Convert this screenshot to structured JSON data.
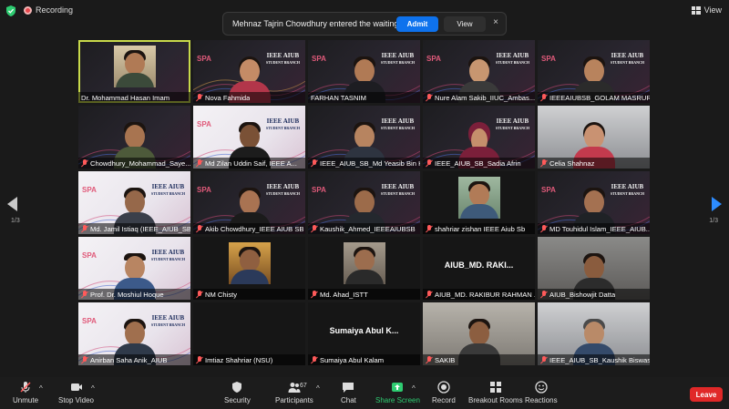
{
  "topbar": {
    "recording_label": "Recording",
    "view_label": "View"
  },
  "notification": {
    "message": "Mehnaz Tajrin Chowdhury entered the waiting room",
    "admit_label": "Admit",
    "view_label": "View",
    "close_glyph": "×"
  },
  "pagination": {
    "left": "1/3",
    "right": "1/3"
  },
  "branding": {
    "spa": "SPA",
    "ieee_line1": "IEEE AIUB",
    "ieee_line2": "STUDENT BRANCH"
  },
  "participants": [
    {
      "name": "Dr. Mohammad Hasan Imam",
      "muted": false
    },
    {
      "name": "Nova Fahmida",
      "muted": true
    },
    {
      "name": "FARHAN TASNIM",
      "muted": false
    },
    {
      "name": "Nure Alam Sakib_IIUC_Ambas...",
      "muted": true
    },
    {
      "name": "IEEEAIUBSB_GOLAM MASRUR...",
      "muted": true
    },
    {
      "name": "Chowdhury_Mohammad_Saye...",
      "muted": true
    },
    {
      "name": "Md Zilan Uddin Saif, IEEE A...",
      "muted": true
    },
    {
      "name": "IEEE_AIUB_SB_Md Yeasib Bin Has...",
      "muted": true
    },
    {
      "name": "IEEE_AIUB_SB_Sadia Afrin",
      "muted": true
    },
    {
      "name": "Celia Shahnaz",
      "muted": true
    },
    {
      "name": "Md. Jamil Istiaq (IEEE_AIUB_SB)",
      "muted": true
    },
    {
      "name": "Akib Chowdhury_IEEE AIUB SB",
      "muted": true
    },
    {
      "name": "Kaushik_Ahmed_IEEEAIUBSB",
      "muted": true
    },
    {
      "name": "shahriar zishan IEEE Aiub Sb",
      "muted": true
    },
    {
      "name": "MD Touhidul Islam_IEEE_AIUB...",
      "muted": true
    },
    {
      "name": "Prof. Dr. Moshiul Hoque",
      "muted": true
    },
    {
      "name": "NM Chisty",
      "muted": true
    },
    {
      "name": "Md. Ahad_ISTT",
      "muted": true
    },
    {
      "name": "AIUB_MD. RAKIBUR RAHMAN ...",
      "muted": true,
      "big_label": "AIUB_MD. RAKI..."
    },
    {
      "name": "AIUB_Bishowjit Datta",
      "muted": true
    },
    {
      "name": "Anirban Saha Anik_AIUB",
      "muted": true
    },
    {
      "name": "Imtiaz Shahriar (NSU)",
      "muted": true
    },
    {
      "name": "Sumaiya Abul Kalam",
      "muted": true,
      "big_label": "Sumaiya Abul K..."
    },
    {
      "name": "SAKIB",
      "muted": true
    },
    {
      "name": "IEEE_AIUB_SB_Kaushik Biswas",
      "muted": true
    }
  ],
  "toolbar": {
    "unmute": "Unmute",
    "stop_video": "Stop Video",
    "security": "Security",
    "participants": "Participants",
    "participants_count": "67",
    "chat": "Chat",
    "share_screen": "Share Screen",
    "record": "Record",
    "breakout": "Breakout Rooms",
    "reactions": "Reactions",
    "leave": "Leave",
    "caret": "^"
  },
  "colors": {
    "accent": "#0e72ed",
    "active_speaker": "#c8d94a",
    "leave": "#e02828",
    "share": "#2ecc71",
    "muted_icon": "#ff5a5a"
  }
}
